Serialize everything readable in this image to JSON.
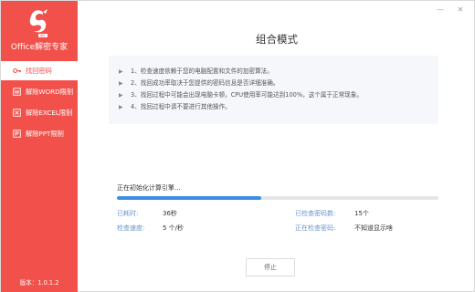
{
  "app": {
    "title": "Office解密专家",
    "version": "版本：1.0.1.2"
  },
  "sidebar": {
    "items": [
      {
        "label": "找回密码",
        "icon": "key-icon",
        "active": true
      },
      {
        "label": "解除WORD限制",
        "icon": "word-icon",
        "active": false
      },
      {
        "label": "解除EXCEL限制",
        "icon": "excel-icon",
        "active": false
      },
      {
        "label": "解除PPT限制",
        "icon": "ppt-icon",
        "active": false
      }
    ]
  },
  "window_controls": {
    "minimize": "—",
    "close": "✕"
  },
  "main": {
    "title": "组合模式",
    "info": [
      "1、检查速度依赖于您的电脑配置和文件的加密算法。",
      "2、找回成功率取决于您提供的密码信息是否详细准确。",
      "3、找回过程中可能会出现电脑卡顿，CPU使用率可能达到100%，这个属于正常现象。",
      "4、找回过程中请不要进行其他操作。"
    ],
    "progress": {
      "label": "正在初始化计算引擎...",
      "percent": 45
    },
    "stats": {
      "elapsed_label": "已耗时:",
      "elapsed_value": "36秒",
      "checked_label": "已检查密码数:",
      "checked_value": "15个",
      "speed_label": "检查速度:",
      "speed_value": "5 个/秒",
      "current_label": "正在检查密码:",
      "current_value": "不知道显示啥"
    },
    "stop_label": "停止"
  },
  "colors": {
    "brand": "#f2504a",
    "progress": "#3b8fe0",
    "stat_label": "#6b95c9"
  }
}
